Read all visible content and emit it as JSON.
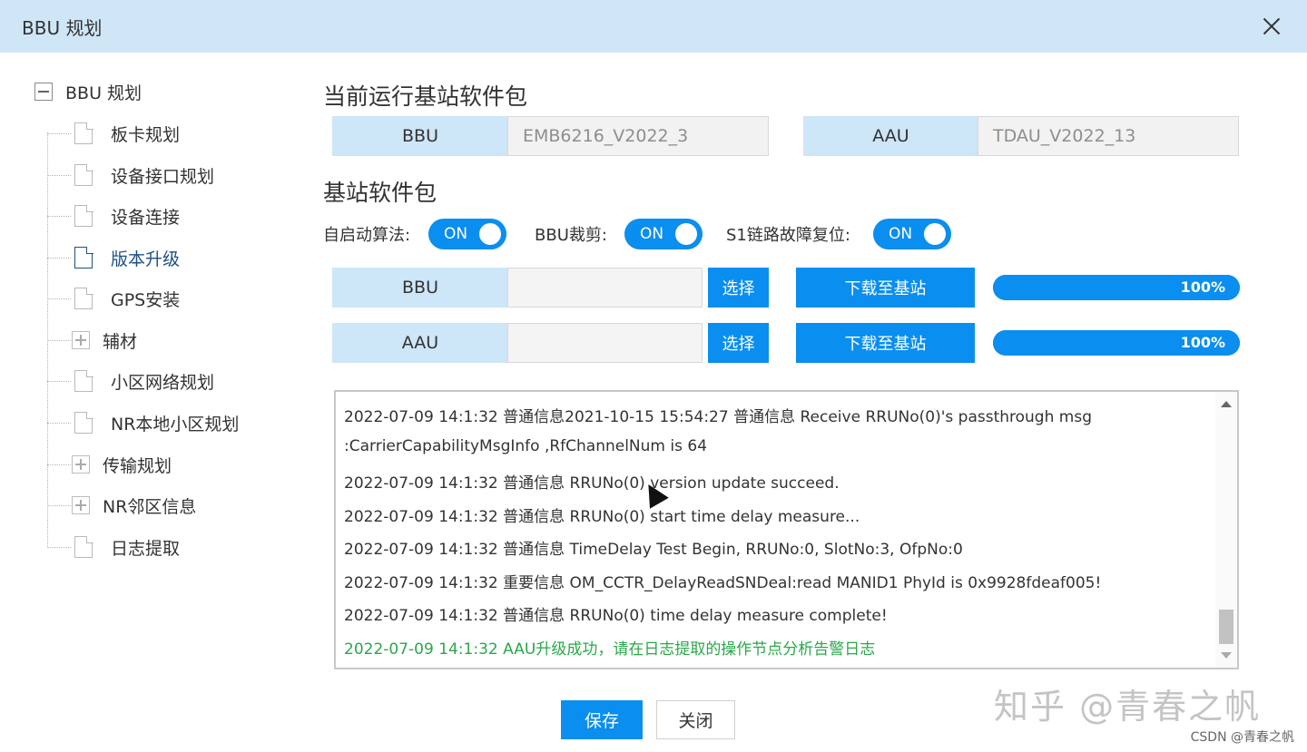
{
  "window": {
    "title": "BBU 规划"
  },
  "tree": {
    "root": "BBU 规划",
    "items": [
      {
        "label": "板卡规划",
        "type": "page"
      },
      {
        "label": "设备接口规划",
        "type": "page"
      },
      {
        "label": "设备连接",
        "type": "page"
      },
      {
        "label": "版本升级",
        "type": "page",
        "active": true
      },
      {
        "label": "GPS安装",
        "type": "page"
      },
      {
        "label": "辅材",
        "type": "folder"
      },
      {
        "label": "小区网络规划",
        "type": "page"
      },
      {
        "label": "NR本地小区规划",
        "type": "page"
      },
      {
        "label": "传输规划",
        "type": "folder"
      },
      {
        "label": "NR邻区信息",
        "type": "folder"
      },
      {
        "label": "日志提取",
        "type": "page"
      }
    ]
  },
  "current_pkg": {
    "title": "当前运行基站软件包",
    "bbu_label": "BBU",
    "bbu_value": "EMB6216_V2022_3",
    "aau_label": "AAU",
    "aau_value": "TDAU_V2022_13"
  },
  "pkg": {
    "title": "基站软件包",
    "toggles": [
      {
        "label": "自启动算法:",
        "state": "ON"
      },
      {
        "label": "BBU裁剪:",
        "state": "ON"
      },
      {
        "label": "S1链路故障复位:",
        "state": "ON"
      }
    ],
    "rows": [
      {
        "label": "BBU",
        "value": "",
        "select_label": "选择",
        "download_label": "下载至基站",
        "progress": 100,
        "progress_text": "100%"
      },
      {
        "label": "AAU",
        "value": "",
        "select_label": "选择",
        "download_label": "下载至基站",
        "progress": 100,
        "progress_text": "100%"
      }
    ]
  },
  "log": {
    "lines": [
      "2022-07-09 14:1:32 普通信息2021-10-15 15:54:27 普通信息 Receive RRUNo(0)'s passthrough msg",
      ":CarrierCapabilityMsgInfo ,RfChannelNum is 64",
      "2022-07-09 14:1:32 普通信息 RRUNo(0) version update succeed.",
      "2022-07-09 14:1:32 普通信息 RRUNo(0) start time delay measure...",
      "2022-07-09 14:1:32 普通信息 TimeDelay Test Begin, RRUNo:0, SlotNo:3, OfpNo:0",
      "2022-07-09 14:1:32 重要信息 OM_CCTR_DelayReadSNDeal:read MANID1 PhyId is 0x9928fdeaf005!",
      "2022-07-09 14:1:32 普通信息 RRUNo(0) time delay measure complete!",
      "2022-07-09 14:1:32 AAU升级成功，请在日志提取的操作节点分析告警日志"
    ],
    "success_color": "#2aa84a"
  },
  "footer": {
    "save_label": "保存",
    "close_label": "关闭"
  },
  "watermark": {
    "text": "知乎 @青春之帆",
    "credit": "CSDN @青春之帆"
  },
  "colors": {
    "accent": "#0a8ef0",
    "titlebar": "#cfe6f7",
    "label_bg": "#cde6f8",
    "active_tree": "#1e4f86"
  }
}
